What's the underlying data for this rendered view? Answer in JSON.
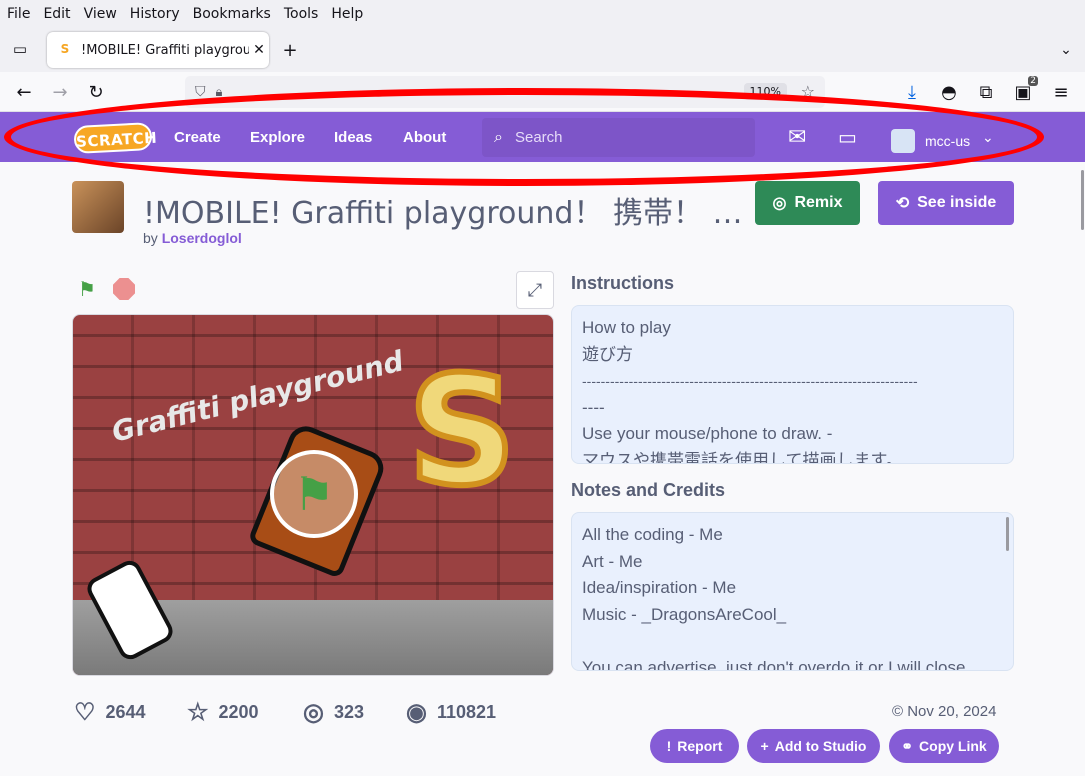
{
  "browser": {
    "menu": [
      "File",
      "Edit",
      "View",
      "History",
      "Bookmarks",
      "Tools",
      "Help"
    ],
    "tab_title": "!MOBILE! Graffiti playgrou",
    "zoom": "110%",
    "notification_count": "2"
  },
  "scratch_nav": {
    "logo": "SCRATCH",
    "links": [
      "Create",
      "Explore",
      "Ideas",
      "About"
    ],
    "search_placeholder": "Search",
    "username": "mcc-us"
  },
  "project": {
    "title": "!MOBILE! Graffiti playground！ 携帯！ …",
    "by_label": "by",
    "author": "Loserdoglol",
    "remix_label": "Remix",
    "see_inside_label": "See inside",
    "stage_title_text": "Graffiti playground"
  },
  "instructions": {
    "heading": "Instructions",
    "lines": [
      "How to play",
      "遊び方",
      "------------------------------------------------------------------------",
      "----",
      "Use your mouse/phone to draw. -",
      "マウスや携帯電話を使用して描画します。"
    ]
  },
  "notes": {
    "heading": "Notes and Credits",
    "lines": [
      "All the coding - Me",
      "Art - Me",
      "Idea/inspiration - Me",
      "Music - _DragonsAreCool_",
      "",
      "You can advertise, just don't overdo it or I will close"
    ]
  },
  "stats": {
    "loves": "2644",
    "favorites": "2200",
    "remixes": "323",
    "views": "110821",
    "date": "© Nov 20, 2024"
  },
  "actions": {
    "report": "Report",
    "add_to_studio": "Add to Studio",
    "copy_link": "Copy Link"
  },
  "colors": {
    "scratch_purple": "#855cd6",
    "remix_green": "#2e8a57",
    "annotation_red": "#ff0000"
  }
}
